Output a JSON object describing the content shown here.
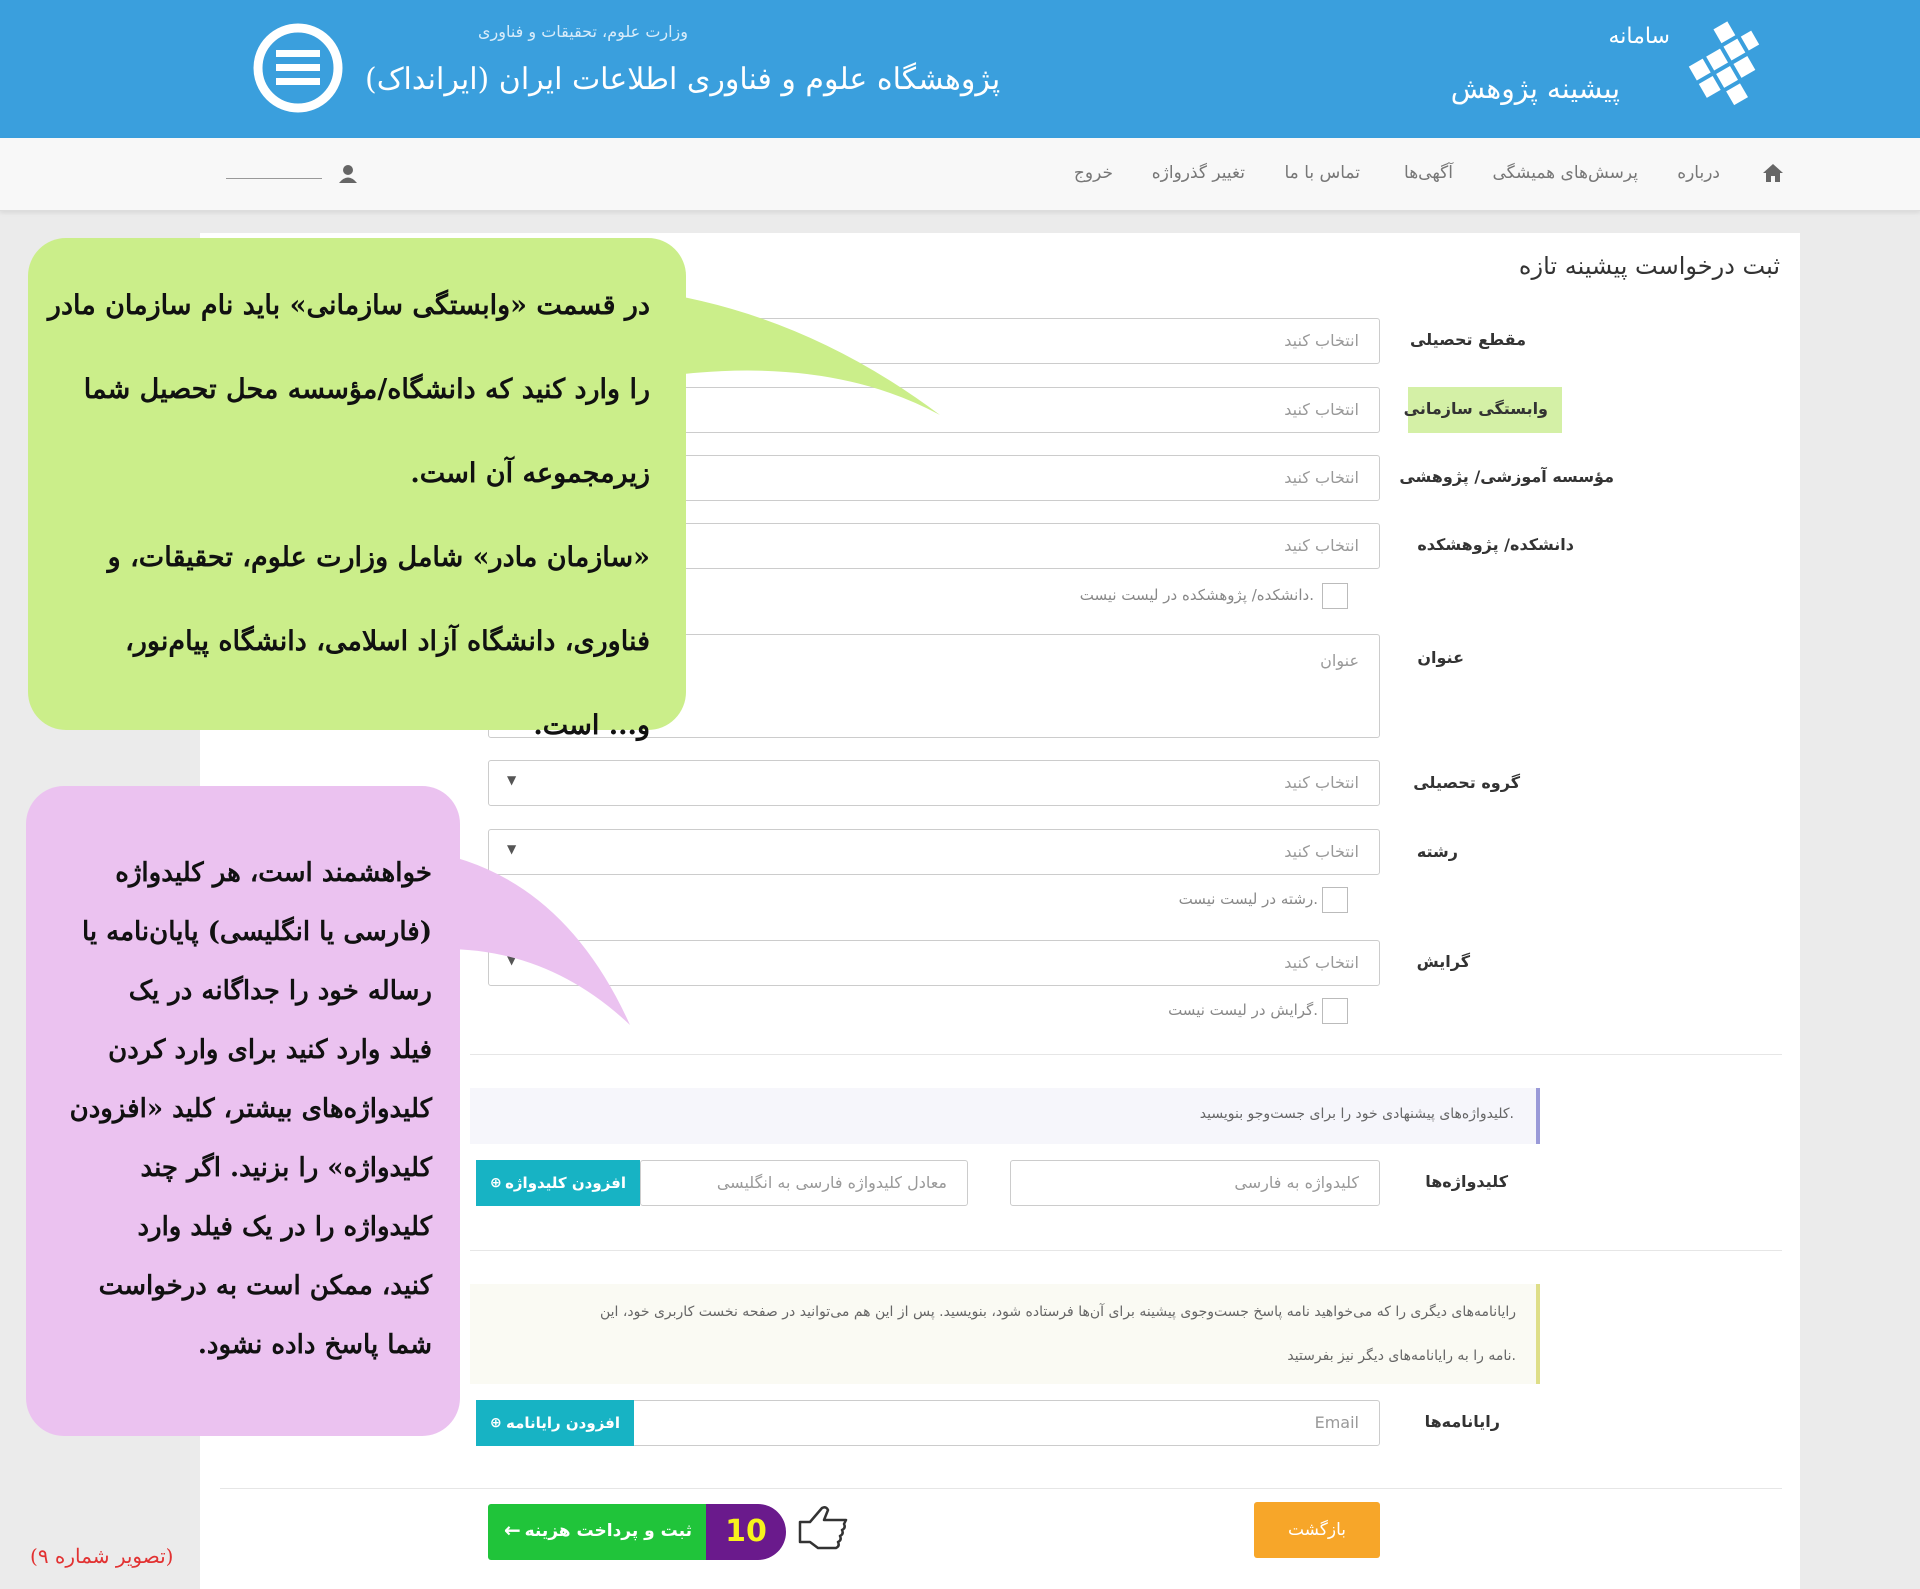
{
  "header": {
    "system_label": "سامانه",
    "system_name": "پیشینه پژوهش",
    "ministry": "وزارت علوم، تحقیقات و فناوری",
    "institute": "پژوهشگاه علوم و فناوری اطلاعات ایران (ایرانداک)"
  },
  "nav": {
    "about": "درباره",
    "faq": "پرسش‌های همیشگی",
    "ads": "آگهی‌ها",
    "contact": "تماس با ما",
    "change_password": "تغییر گذرواژه",
    "logout": "خروج"
  },
  "form": {
    "title": "ثبت درخواست پیشینه تازه",
    "select_placeholder": "انتخاب کنید",
    "labels": {
      "degree": "مقطع تحصیلی",
      "affiliation": "وابستگی سازمانی",
      "institute": "مؤسسه آموزشی/ پژوهشی",
      "faculty": "دانشکده/ پژوهشکده",
      "title": "عنوان",
      "group": "گروه تحصیلی",
      "field": "رشته",
      "orientation": "گرایش",
      "keywords": "کلیدواژه‌ها",
      "emails": "رایانامه‌ها"
    },
    "faculty_not_listed": "دانشکده/ پژوهشکده در لیست نیست.",
    "title_placeholder": "عنوان",
    "field_not_listed": "رشته در لیست نیست.",
    "orientation_not_listed": "گرایش در لیست نیست.",
    "keywords_info": "کلیدواژه‌های پیشنهادی خود را برای جست‌وجو بنویسید.",
    "keyword_fa_placeholder": "کلیدواژه به فارسی",
    "keyword_en_placeholder": "معادل کلیدواژه فارسی به انگلیسی",
    "add_keyword": "افزودن کلیدواژه",
    "emails_info_line1": "رایانامه‌های دیگری را که می‌خواهید نامه پاسخ جست‌وجوی پیشینه برای آن‌ها فرستاده شود، بنویسید. پس از این هم می‌توانید در صفحه نخست کاربری خود، این",
    "emails_info_line2": "نامه را به رایانامه‌های دیگر نیز بفرستید.",
    "email_placeholder": "Email",
    "add_email": "افزودن رایانامه",
    "back": "بازگشت",
    "submit": "ثبت و پرداخت هزینه",
    "step_number": "10"
  },
  "callouts": {
    "green": [
      "در قسمت «وابستگی سازمانی» باید نام سازمان مادر",
      "را وارد کنید که دانشگاه/مؤسسه محل تحصیل شما",
      "زیرمجموعه آن است.",
      "«سازمان مادر» شامل وزارت علوم، تحقیقات، و",
      "فناوری، دانشگاه آزاد اسلامی، دانشگاه پیام‌نور،",
      "و... است."
    ],
    "pink": [
      "خواهشمند است، هر کلیدواژه",
      "(فارسی یا انگلیسی) پایان‌نامه یا",
      "رساله خود را جداگانه در یک",
      "فیلد وارد کنید برای وارد کردن",
      "کلیدواژه‌های بیشتر، کلید «افزودن",
      "کلیدواژه» را بزنید. اگر چند",
      "کلیدواژه را در یک فیلد وارد",
      "کنید، ممکن است به درخواست",
      "شما پاسخ داده نشود."
    ]
  },
  "caption": "(تصویر شماره ۹)",
  "colors": {
    "header_blue": "#3a9fdd",
    "teal": "#17b3c4",
    "orange": "#f7a629",
    "green": "#20c43a",
    "callout_green": "#cbee8a",
    "callout_pink": "#ebc2f0"
  }
}
